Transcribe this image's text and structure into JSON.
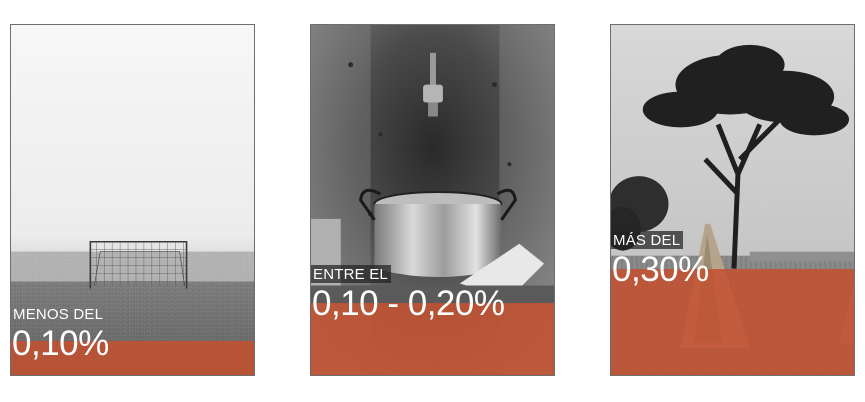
{
  "colors": {
    "accent": "#c4502f",
    "text": "#ffffff"
  },
  "cards": [
    {
      "prefix": "MENOS DEL",
      "value": "0,10%",
      "image": "foggy-football-goal-photo"
    },
    {
      "prefix": "ENTRE EL",
      "value": "0,10 - 0,20%",
      "image": "tap-and-cooking-pot-photo"
    },
    {
      "prefix": "MÁS DEL",
      "value": "0,30%",
      "image": "acacia-tree-and-straw-bundles-photo"
    }
  ]
}
